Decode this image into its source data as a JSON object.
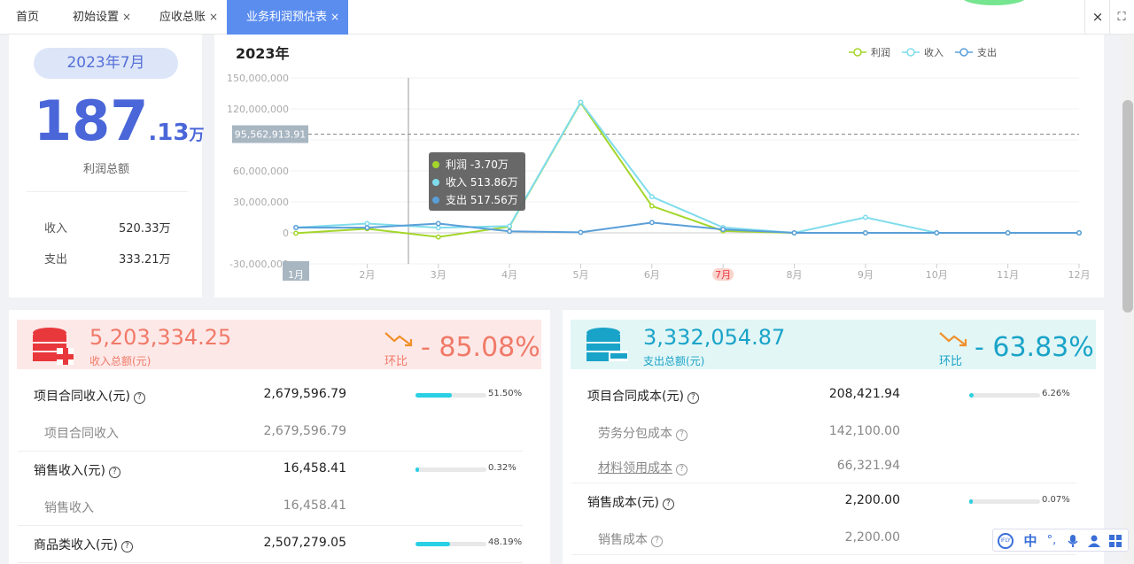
{
  "tabs": [
    {
      "label": "首页",
      "closable": false
    },
    {
      "label": "初始设置",
      "closable": true
    },
    {
      "label": "应收总账",
      "closable": true
    },
    {
      "label": "业务利润预估表",
      "closable": true,
      "active": true
    }
  ],
  "tab_close_glyph": "×",
  "window_buttons": {
    "close": "×",
    "fullscreen": "⛶"
  },
  "summary": {
    "month": "2023年7月",
    "profit_int": "187",
    "profit_dec": ".13",
    "profit_unit": "万",
    "profit_label": "利润总额",
    "income_label": "收入",
    "income_value": "520.33万",
    "expense_label": "支出",
    "expense_value": "333.21万"
  },
  "chart_data": {
    "type": "line",
    "title": "2023年",
    "categories": [
      "1月",
      "2月",
      "3月",
      "4月",
      "5月",
      "6月",
      "7月",
      "8月",
      "9月",
      "10月",
      "11月",
      "12月"
    ],
    "highlight_category": "7月",
    "ylim": [
      -30000000,
      150000000
    ],
    "yticks": [
      "150,000,000",
      "120,000,000",
      "95,562,913.91",
      "60,000,000",
      "30,000,000",
      "0",
      "-30,000,000"
    ],
    "marker_line": {
      "value": 95562913.91,
      "label": "95,562,913.91"
    },
    "legend_position": "top-right",
    "series": [
      {
        "name": "利润",
        "color": "#a4d62a",
        "values": [
          -370000,
          4000000,
          -4000000,
          6000000,
          126000000,
          26000000,
          1870000,
          0,
          0,
          0,
          0,
          0
        ]
      },
      {
        "name": "收入",
        "color": "#7fdcec",
        "values": [
          5140000,
          9000000,
          5000000,
          6500000,
          126500000,
          35000000,
          5203334,
          0,
          15000000,
          0,
          0,
          0
        ]
      },
      {
        "name": "支出",
        "color": "#5a9fd8",
        "values": [
          5180000,
          5000000,
          9000000,
          1500000,
          500000,
          10000000,
          3332055,
          0,
          0,
          0,
          0,
          0
        ]
      }
    ],
    "crosshair_category": "1月",
    "tooltip": [
      {
        "name": "利润",
        "value": "-3.70万"
      },
      {
        "name": "收入",
        "value": "513.86万"
      },
      {
        "name": "支出",
        "value": "517.56万"
      }
    ]
  },
  "income": {
    "total": "5,203,334.25",
    "total_label": "收入总额(元)",
    "huanbi_label": "环比",
    "huanbi_value": "- 85.08%",
    "color": "#f07a68",
    "bg": "#fde8e8",
    "rows": [
      {
        "label": "项目合同收入(元)",
        "value": "2,679,596.79",
        "pct": 0.515,
        "pct_text": "51.50%",
        "subs": [
          {
            "label": "项目合同收入",
            "value": "2,679,596.79"
          }
        ]
      },
      {
        "label": "销售收入(元)",
        "value": "16,458.41",
        "pct": 0.0032,
        "pct_text": "0.32%",
        "subs": [
          {
            "label": "销售收入",
            "value": "16,458.41"
          }
        ]
      },
      {
        "label": "商品类收入(元)",
        "value": "2,507,279.05",
        "pct": 0.4819,
        "pct_text": "48.19%",
        "subs": []
      }
    ]
  },
  "expense": {
    "total": "3,332,054.87",
    "total_label": "支出总额(元)",
    "huanbi_label": "环比",
    "huanbi_value": "- 63.83%",
    "color": "#1aa3c8",
    "bg": "#e2f6f6",
    "rows": [
      {
        "label": "项目合同成本(元)",
        "value": "208,421.94",
        "pct": 0.0626,
        "pct_text": "6.26%",
        "subs": [
          {
            "label": "劳务分包成本",
            "value": "142,100.00"
          },
          {
            "label": "材料领用成本",
            "value": "66,321.94"
          }
        ]
      },
      {
        "label": "销售成本(元)",
        "value": "2,200.00",
        "pct": 0.0007,
        "pct_text": "0.07%",
        "subs": [
          {
            "label": "销售成本",
            "value": "2,200.00"
          }
        ]
      }
    ]
  },
  "ime_toolbar": {
    "logo": "iFLY",
    "items": [
      "中",
      "°,",
      "🎤",
      "👤",
      "▦"
    ]
  }
}
